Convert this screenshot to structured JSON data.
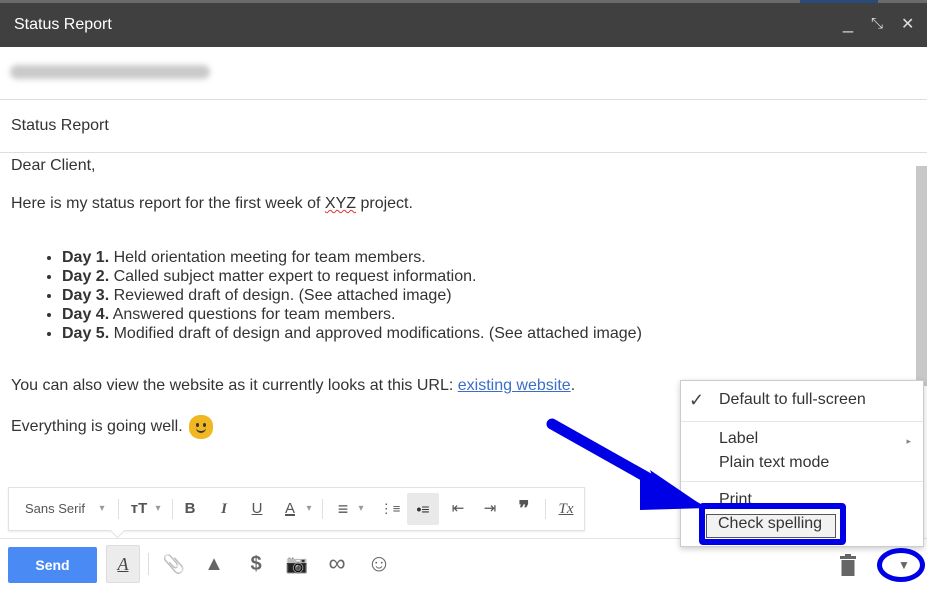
{
  "window": {
    "title": "Status Report",
    "controls": {
      "minimize": "_",
      "popout": "⤡",
      "close": "✕"
    }
  },
  "recipients": {
    "value_obscured": true
  },
  "subject": {
    "value": "Status Report"
  },
  "body": {
    "greeting": "Dear Client,",
    "intro_before": "Here is my status report for the first week of ",
    "intro_misspelled": "XYZ",
    "intro_after": " project.",
    "items": [
      {
        "day": "Day 1.",
        "text": " Held orientation meeting for team members."
      },
      {
        "day": "Day 2.",
        "text": " Called subject matter expert to request information."
      },
      {
        "day": "Day 3.",
        "text": " Reviewed draft of design. (See attached image)"
      },
      {
        "day": "Day 4.",
        "text": " Answered questions for team members."
      },
      {
        "day": "Day 5.",
        "text": " Modified draft of design and approved modifications. (See attached image)"
      }
    ],
    "url_line": "You can also view the website as it currently looks at this URL: ",
    "link_text": "existing website",
    "url_line_end": ".",
    "closing": "Everything is going well.",
    "emoji": "smiley-emoji"
  },
  "format_toolbar": {
    "font": "Sans Serif",
    "font_caret": "▾",
    "size_icon": "ᴛT",
    "bold": "B",
    "italic": "I",
    "underline": "U",
    "text_color": "A",
    "align": "≡",
    "numbered_list": "⋮≡",
    "bulleted_list": "•≡",
    "indent_less": "⇤",
    "indent_more": "⇥",
    "quote": "❞",
    "clear_format": "Tx"
  },
  "bottom_bar": {
    "send": "Send",
    "format_button": "A",
    "attach": "📎",
    "drive": "▲",
    "money": "$",
    "photo": "📷",
    "link": "∞",
    "emoji": "☺",
    "more": "▼"
  },
  "more_menu": {
    "items": [
      {
        "label": "Default to full-screen",
        "checked": true
      },
      {
        "label": "Label",
        "has_submenu": true
      },
      {
        "label": "Plain text mode"
      },
      {
        "label": "Print"
      },
      {
        "label": "Check spelling",
        "highlighted": true
      }
    ],
    "check_glyph": "✓",
    "submenu_glyph": "▸"
  },
  "colors": {
    "title_bar": "#404040",
    "send_button": "#4a8af4",
    "link": "#3b6ec8",
    "annotation": "#0000e6",
    "emoji": "#f1b722"
  }
}
